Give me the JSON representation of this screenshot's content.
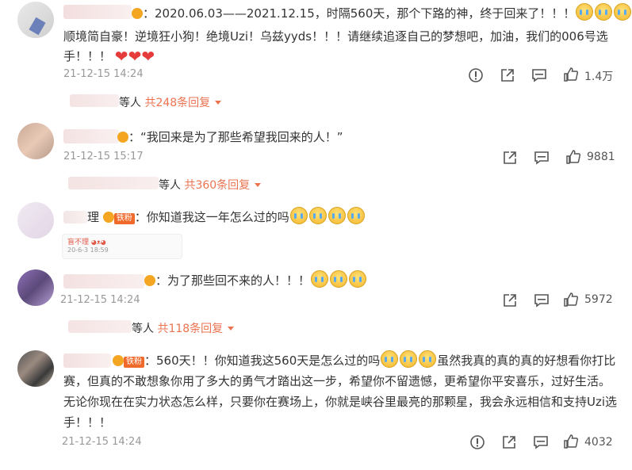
{
  "comments": [
    {
      "lines": [
        "：2020.06.03——2021.12.15，时隔560天，那个下路的神，终于回来了！！！",
        "顺境简自豪！逆境狂小狗！绝境Uzi！乌兹yyds！！！请继续追逐自己的梦想吧，加油，我们的006号选",
        "手！！！"
      ],
      "time": "21-12-15 14:24",
      "likes": "1.4万",
      "replies_prefix": "等人",
      "replies_link": "共248条回复"
    },
    {
      "lines": [
        "：“我回来是为了那些希望我回来的人！”"
      ],
      "time": "21-12-15 15:17",
      "likes": "9881",
      "replies_prefix": "等人",
      "replies_link": "共360条回复"
    },
    {
      "name_tail": "理",
      "fan_badge": "铁粉",
      "lines": [
        "：你知道我这一年怎么过的吗"
      ],
      "quote_name": "盲不理",
      "quote_date": "20-6-3 18:59"
    },
    {
      "lines": [
        "：为了那些回不来的人！！！"
      ],
      "time": "21-12-15 14:24",
      "likes": "5972",
      "replies_prefix": "等人",
      "replies_link": "共118条回复"
    },
    {
      "fan_badge": "铁粉",
      "lines": [
        "：560天！！你知道我这560天是怎么过的吗",
        "虽然我真的真的真的好想看你打比",
        "赛，但真的不敢想象你用了多大的勇气才踏出这一步，希望你不留遗憾，更希望你平安喜乐，过好生活。",
        "无论你现在在实力状态怎么样，只要你在赛场上，你就是峡谷里最亮的那颗星，我会永远相信和支持Uzi选",
        "手！！！"
      ],
      "time": "21-12-15 14:24",
      "likes": "4032"
    }
  ],
  "icons": {
    "report": "report-icon",
    "share": "share-icon",
    "comment": "comment-icon",
    "like": "thumbs-up-icon"
  }
}
